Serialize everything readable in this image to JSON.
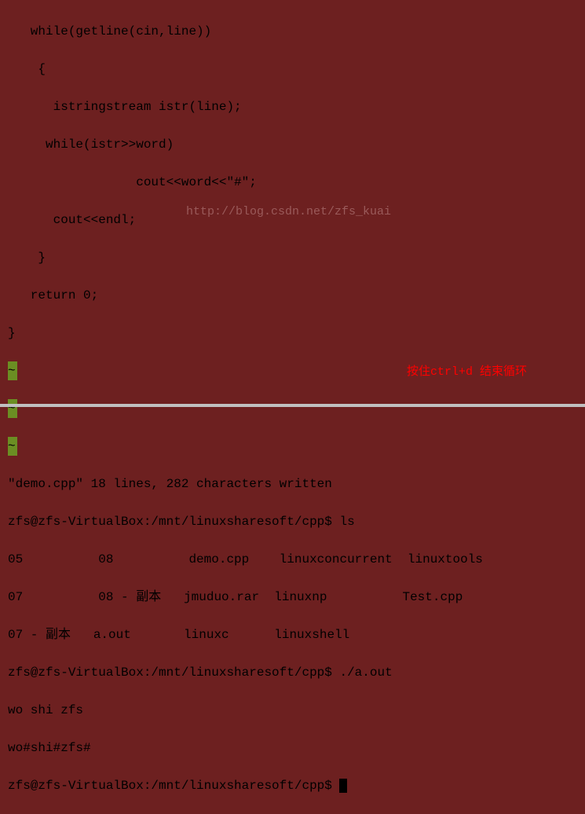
{
  "code": {
    "line1": "   while(getline(cin,line))",
    "line2": "    {",
    "line3": "      istringstream istr(line);",
    "line4": "     while(istr>>word)",
    "line5": "                 cout<<word<<\"#\";",
    "line6": "      cout<<endl;",
    "line7": "    }",
    "line8": "   return 0;",
    "line9": "}"
  },
  "tilde": "~",
  "watermark": "http://blog.csdn.net/zfs_kuai",
  "terminal": {
    "msg1": "\"demo.cpp\" 18 lines, 282 characters written",
    "prompt1": "zfs@zfs-VirtualBox:/mnt/linuxsharesoft/cpp$ ls",
    "ls1": "05          08          demo.cpp    linuxconcurrent  linuxtools",
    "ls2": "07          08 - 副本   jmuduo.rar  linuxnp          Test.cpp",
    "ls3": "07 - 副本   a.out       linuxc      linuxshell",
    "prompt2": "zfs@zfs-VirtualBox:/mnt/linuxsharesoft/cpp$ ./a.out",
    "input1": "wo shi zfs",
    "output1": "wo#shi#zfs#",
    "prompt3": "zfs@zfs-VirtualBox:/mnt/linuxsharesoft/cpp$ "
  },
  "annotation": "按住ctrl+d 结束循环"
}
